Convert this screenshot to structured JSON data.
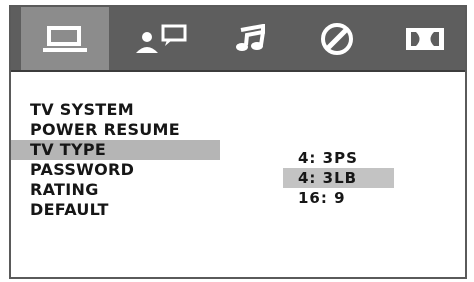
{
  "tabs": [
    {
      "icon": "monitor-icon",
      "active": true
    },
    {
      "icon": "person-speech-icon",
      "active": false
    },
    {
      "icon": "music-note-icon",
      "active": false
    },
    {
      "icon": "slash-circle-icon",
      "active": false
    },
    {
      "icon": "dolby-icon",
      "active": false
    }
  ],
  "menu": {
    "items": [
      {
        "label": "TV SYSTEM"
      },
      {
        "label": "POWER RESUME"
      },
      {
        "label": "TV TYPE",
        "selected": true
      },
      {
        "label": "PASSWORD"
      },
      {
        "label": "RATING"
      },
      {
        "label": "DEFAULT"
      }
    ]
  },
  "options": {
    "items": [
      {
        "label": "4: 3PS"
      },
      {
        "label": "4: 3LB",
        "selected": true
      },
      {
        "label": "16: 9"
      }
    ]
  },
  "colors": {
    "tab_bar": "#5e5e5e",
    "tab_active": "#8c8c8c",
    "selection": "#b5b5b5",
    "icon": "#ffffff",
    "text": "#161616"
  }
}
